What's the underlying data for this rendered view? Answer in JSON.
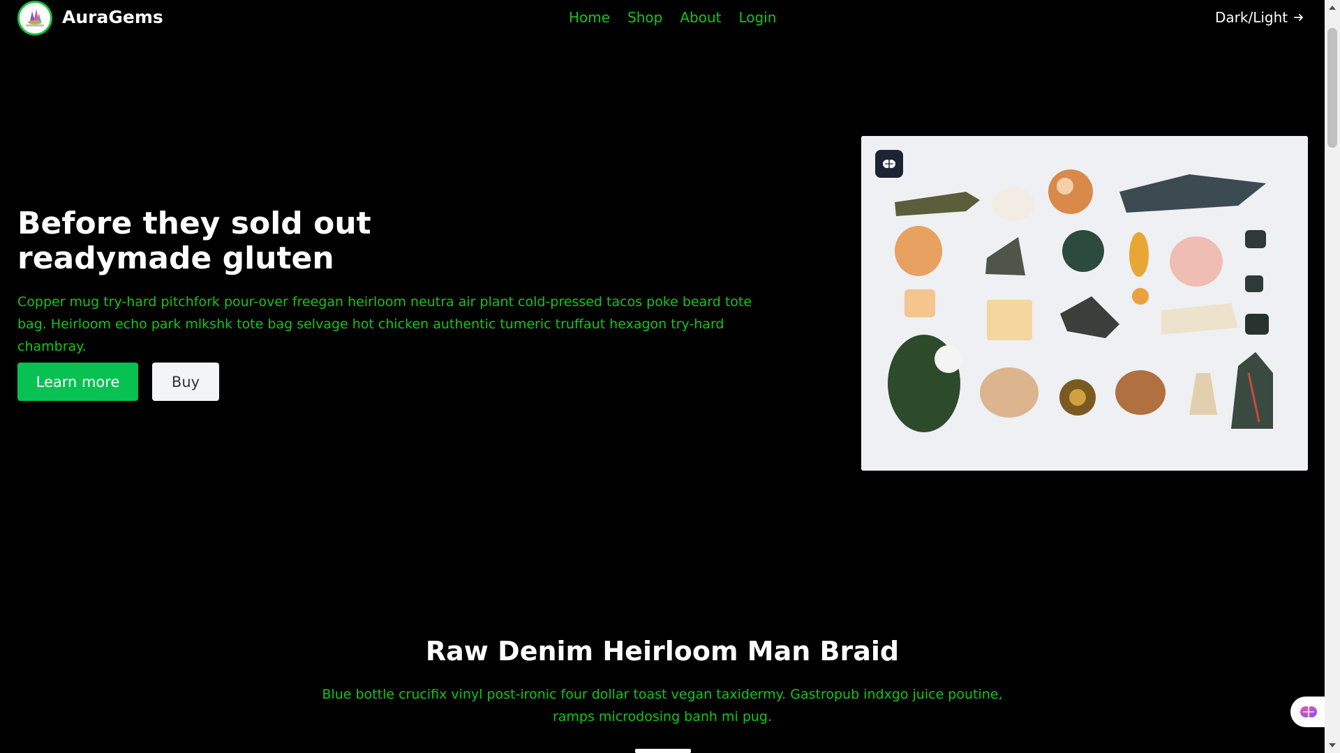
{
  "header": {
    "brand": "AuraGems",
    "logo_icon": "crystal-logo",
    "nav": [
      {
        "label": "Home"
      },
      {
        "label": "Shop"
      },
      {
        "label": "About"
      },
      {
        "label": "Login"
      }
    ],
    "theme_toggle": "Dark/Light",
    "accent_color": "#10c816"
  },
  "hero": {
    "title": "Before they sold out readymade gluten",
    "text": "Copper mug try-hard pitchfork pour-over freegan heirloom neutra air plant cold-pressed tacos poke beard tote bag. Heirloom echo park mlkshk tote bag selvage hot chicken authentic tumeric truffaut hexagon try-hard chambray.",
    "learn_more": "Learn more",
    "buy": "Buy",
    "image_icon": "brain-icon"
  },
  "section": {
    "title": "Raw Denim Heirloom Man Braid",
    "text": "Blue bottle crucifix vinyl post-ironic four dollar toast vegan taxidermy. Gastropub indxgo juice poutine, ramps microdosing banh mi pug."
  },
  "widget": {
    "icon": "brain-icon"
  }
}
